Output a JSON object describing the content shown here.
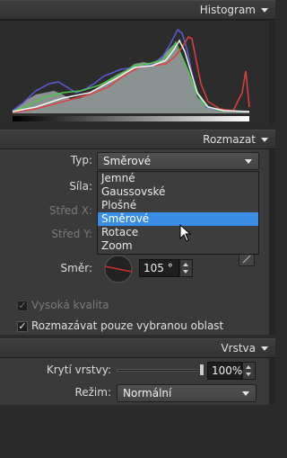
{
  "histogram": {
    "title": "Histogram"
  },
  "blur": {
    "title": "Rozmazat",
    "type_label": "Typ:",
    "type_value": "Směrové",
    "type_options": [
      "Jemné",
      "Gaussovské",
      "Plošné",
      "Směrové",
      "Rotace",
      "Zoom"
    ],
    "selected_index": 3,
    "strength_label": "Síla:",
    "center_x_label": "Střed X:",
    "center_y_label": "Střed Y:",
    "direction_label": "Směr:",
    "direction_value": "105 °",
    "high_quality_label": "Vysoká kvalita",
    "high_quality_checked": true,
    "selection_only_label": "Rozmazávat pouze vybranou oblast",
    "selection_only_checked": true
  },
  "layer": {
    "title": "Vrstva",
    "opacity_label": "Krytí vrstvy:",
    "opacity_value": "100%",
    "opacity_fraction": 1.0,
    "mode_label": "Režim:",
    "mode_value": "Normální"
  },
  "colors": {
    "selected": "#3a8ee6",
    "direction_line": "#d03030"
  }
}
